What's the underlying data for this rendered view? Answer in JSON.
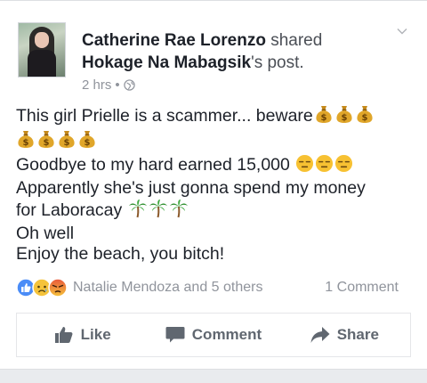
{
  "post": {
    "author": "Catherine Rae Lorenzo",
    "action_text": " shared",
    "shared_from": "Hokage Na Mabagsik",
    "shared_suffix": "'s post.",
    "time": "2 hrs",
    "separator": "•",
    "privacy_icon": "globe-icon",
    "text": {
      "line1": "This girl Prielle is a scammer... beware",
      "line2": "",
      "line3": "Goodbye to my hard earned 15,000 ",
      "line4": "Apparently she's just gonna spend my money",
      "line5": "for Laboracay ",
      "line6": "Oh well",
      "line7": "Enjoy the beach, you bitch!"
    },
    "emojis": {
      "money_bag": "money-bag-emoji",
      "unamused": "unamused-face-emoji",
      "palm_tree": "palm-tree-emoji"
    }
  },
  "reactions": {
    "types": [
      "like",
      "sad",
      "angry"
    ],
    "summary": "Natalie Mendoza and 5 others",
    "comments": "1 Comment"
  },
  "actions": {
    "like": "Like",
    "comment": "Comment",
    "share": "Share"
  },
  "colors": {
    "accent": "#4267b2",
    "text": "#1d2129",
    "secondary": "#90949c",
    "action": "#606770"
  }
}
